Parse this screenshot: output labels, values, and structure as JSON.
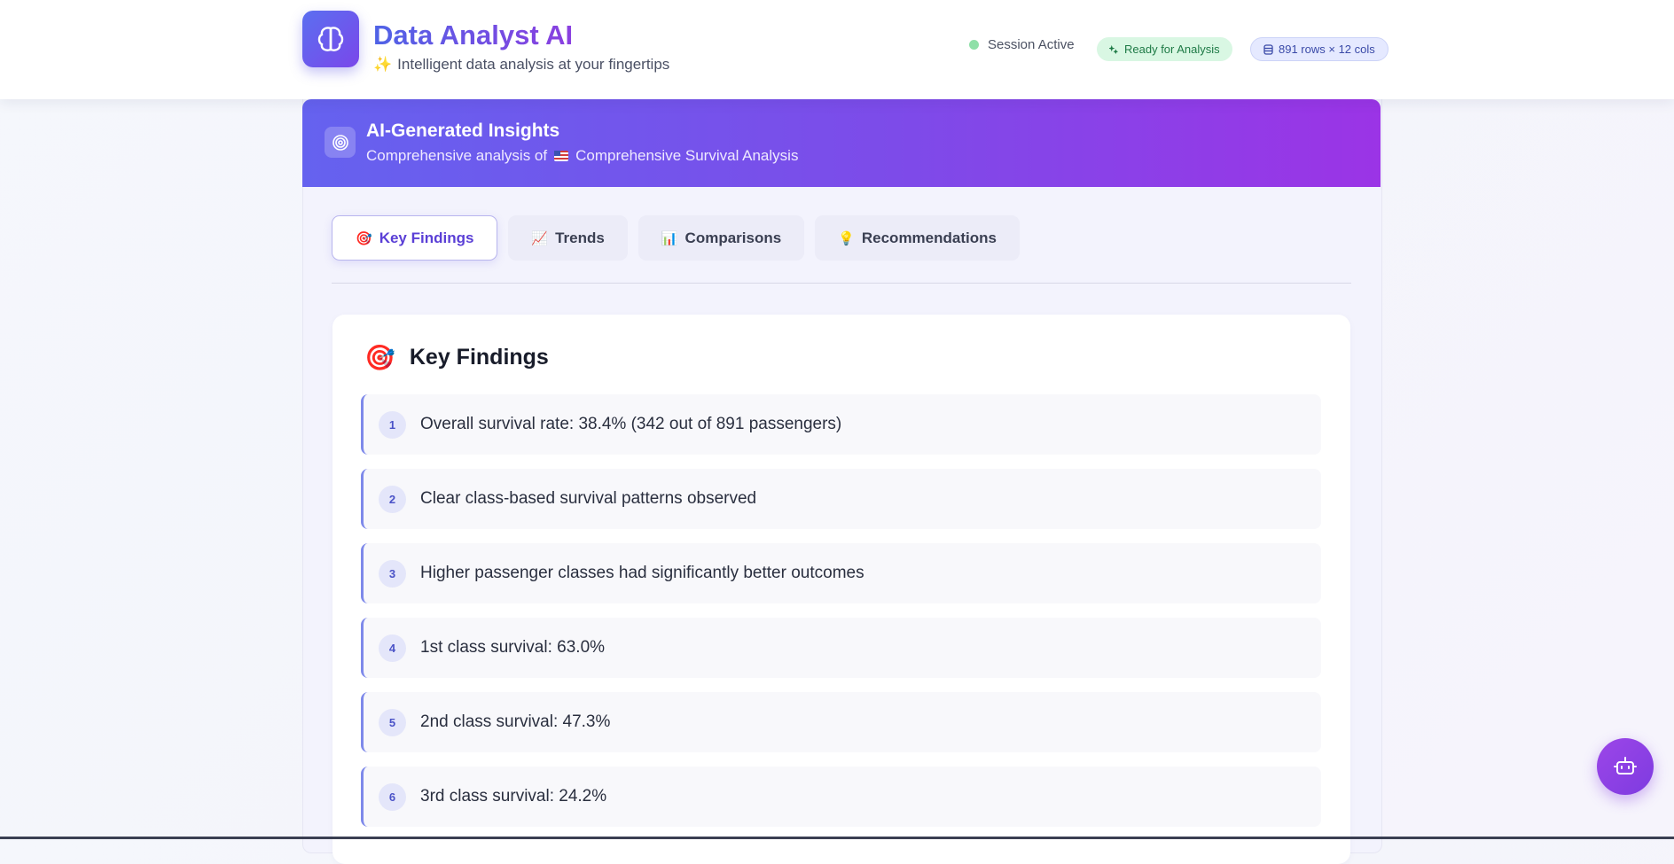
{
  "header": {
    "app_title": "Data Analyst AI",
    "app_subtitle": "Intelligent data analysis at your fingertips",
    "session_status": "Session Active",
    "ready_badge": "Ready for Analysis",
    "dataset_badge": "891 rows × 12 cols"
  },
  "banner": {
    "title": "AI-Generated Insights",
    "subtitle_prefix": "Comprehensive analysis of",
    "subtitle_dataset": "Comprehensive Survival Analysis"
  },
  "tabs": [
    {
      "emoji": "🎯",
      "label": "Key Findings",
      "active": true
    },
    {
      "emoji": "📈",
      "label": "Trends",
      "active": false
    },
    {
      "emoji": "📊",
      "label": "Comparisons",
      "active": false
    },
    {
      "emoji": "💡",
      "label": "Recommendations",
      "active": false
    }
  ],
  "panel": {
    "title": "Key Findings",
    "findings": [
      {
        "num": "1",
        "text": "Overall survival rate: 38.4% (342 out of 891 passengers)"
      },
      {
        "num": "2",
        "text": "Clear class-based survival patterns observed"
      },
      {
        "num": "3",
        "text": "Higher passenger classes had significantly better outcomes"
      },
      {
        "num": "4",
        "text": "1st class survival: 63.0%"
      },
      {
        "num": "5",
        "text": "2nd class survival: 47.3%"
      },
      {
        "num": "6",
        "text": "3rd class survival: 24.2%"
      }
    ]
  },
  "icons": {
    "logo": "brain-icon",
    "banner": "target-icon",
    "ready": "sparkle-icon",
    "dataset": "database-icon",
    "floating": "robot-icon"
  },
  "colors": {
    "accent_start": "#5b6ff0",
    "accent_end": "#9b34e6",
    "status_green": "#8fe0a8"
  }
}
